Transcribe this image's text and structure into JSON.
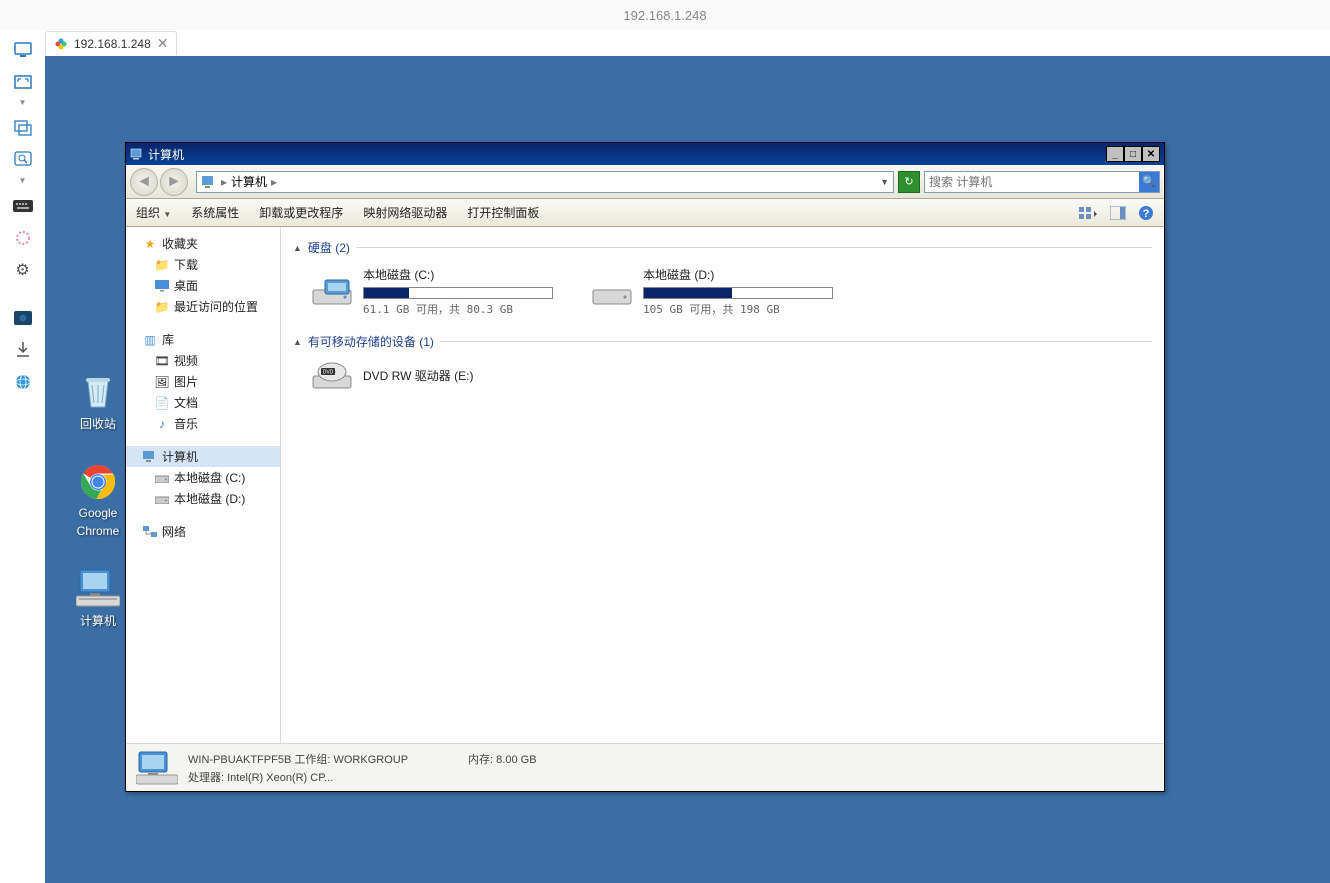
{
  "host": {
    "title": "192.168.1.248",
    "tab_label": "192.168.1.248"
  },
  "desktop_icons": {
    "recycle_bin": "回收站",
    "chrome_line1": "Google",
    "chrome_line2": "Chrome",
    "computer": "计算机"
  },
  "explorer": {
    "title": "计算机",
    "address_label": "计算机",
    "search_placeholder": "搜索 计算机",
    "toolbar": {
      "organize": "组织",
      "system_props": "系统属性",
      "uninstall": "卸载或更改程序",
      "map_drive": "映射网络驱动器",
      "control_panel": "打开控制面板"
    },
    "nav": {
      "favorites": "收藏夹",
      "downloads": "下载",
      "desktop": "桌面",
      "recent": "最近访问的位置",
      "libraries": "库",
      "videos": "视频",
      "pictures": "图片",
      "documents": "文档",
      "music": "音乐",
      "computer": "计算机",
      "drive_c": "本地磁盘 (C:)",
      "drive_d": "本地磁盘 (D:)",
      "network": "网络"
    },
    "groups": {
      "hdd": "硬盘 (2)",
      "removable": "有可移动存储的设备 (1)"
    },
    "drives": {
      "c": {
        "name": "本地磁盘 (C:)",
        "stats": "61.1 GB 可用，共 80.3 GB",
        "fill": 24
      },
      "d": {
        "name": "本地磁盘 (D:)",
        "stats": "105 GB 可用，共 198 GB",
        "fill": 47
      },
      "dvd": {
        "name": "DVD RW 驱动器 (E:)"
      }
    },
    "details": {
      "name": "WIN-PBUAKTFPF5B",
      "workgroup_label": "工作组:",
      "workgroup": "WORKGROUP",
      "memory_label": "内存:",
      "memory": "8.00 GB",
      "cpu_label": "处理器:",
      "cpu": "Intel(R) Xeon(R) CP..."
    }
  }
}
